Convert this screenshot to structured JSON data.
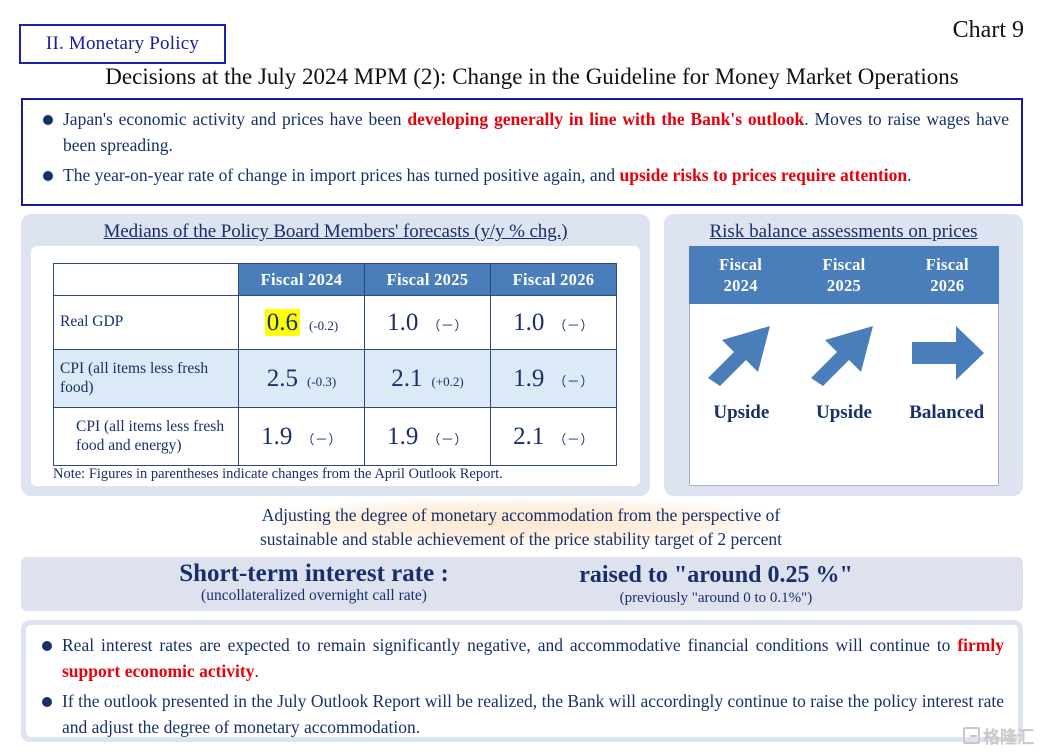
{
  "header": {
    "section_tag": "II. Monetary Policy",
    "chart_number": "Chart 9",
    "title": "Decisions at the July 2024 MPM (2): Change in the Guideline for Money Market Operations"
  },
  "top_bullets": [
    {
      "pre": "Japan's economic activity and prices have been ",
      "highlight": "developing generally in line with the Bank's outlook",
      "post": ". Moves to raise wages have been spreading."
    },
    {
      "pre": "The year-on-year rate of change in import prices has turned positive again, and ",
      "highlight": "upside risks to prices require attention",
      "post": "."
    }
  ],
  "forecast_panel": {
    "heading": "Medians of the Policy Board Members' forecasts (y/y % chg.)",
    "columns": [
      "",
      "Fiscal 2024",
      "Fiscal 2025",
      "Fiscal 2026"
    ],
    "rows": [
      {
        "label": "Real GDP",
        "cells": [
          {
            "value": "0.6",
            "change": "(-0.2)",
            "highlighted": true
          },
          {
            "value": "1.0",
            "change": "（－）",
            "highlighted": false
          },
          {
            "value": "1.0",
            "change": "（－）",
            "highlighted": false
          }
        ]
      },
      {
        "label": "CPI (all items less fresh food)",
        "cells": [
          {
            "value": "2.5",
            "change": "(-0.3)",
            "highlighted": false
          },
          {
            "value": "2.1",
            "change": "(+0.2)",
            "highlighted": false
          },
          {
            "value": "1.9",
            "change": "（－）",
            "highlighted": false
          }
        ]
      },
      {
        "label": "CPI (all items less fresh food and energy)",
        "cells": [
          {
            "value": "1.9",
            "change": "（－）",
            "highlighted": false
          },
          {
            "value": "1.9",
            "change": "（－）",
            "highlighted": false
          },
          {
            "value": "2.1",
            "change": "（－）",
            "highlighted": false
          }
        ]
      }
    ],
    "note": "Note: Figures in parentheses indicate changes from the April Outlook Report."
  },
  "risk_panel": {
    "heading": "Risk balance assessments on prices",
    "columns": [
      {
        "line1": "Fiscal",
        "line2": "2024"
      },
      {
        "line1": "Fiscal",
        "line2": "2025"
      },
      {
        "line1": "Fiscal",
        "line2": "2026"
      }
    ],
    "assessments": [
      {
        "arrow": "arrow-up-right-icon",
        "label": "Upside"
      },
      {
        "arrow": "arrow-up-right-icon",
        "label": "Upside"
      },
      {
        "arrow": "arrow-right-icon",
        "label": "Balanced"
      }
    ]
  },
  "adjust_statement": {
    "line1": "Adjusting the degree of monetary accommodation from the perspective of",
    "line2": "sustainable and stable achievement of the price stability target of 2 percent"
  },
  "rate_banner": {
    "left_main": "Short-term interest rate :",
    "left_sub": "(uncollateralized overnight call rate)",
    "right_main": "raised to \"around 0.25 %\"",
    "right_sub": "(previously \"around 0 to 0.1%\")"
  },
  "bottom_bullets": [
    {
      "pre": "Real interest rates are expected to remain significantly negative, and accommodative financial conditions will continue to ",
      "highlight": "firmly support economic activity",
      "post": "."
    },
    {
      "pre": "If the outlook presented in the July Outlook Report will be realized, the Bank will accordingly continue to raise the policy interest rate and adjust the degree of monetary accommodation.",
      "highlight": "",
      "post": ""
    }
  ],
  "watermark": {
    "text": "格隆汇"
  },
  "colors": {
    "navy": "#17306b",
    "red_highlight": "#e8000d",
    "table_header_blue": "#4a7ebb",
    "panel_bg": "#dde3f0",
    "row_tint": "#dbeaf6",
    "banner_bg": "#dde2ee",
    "yellow_highlight": "#ffff00"
  }
}
